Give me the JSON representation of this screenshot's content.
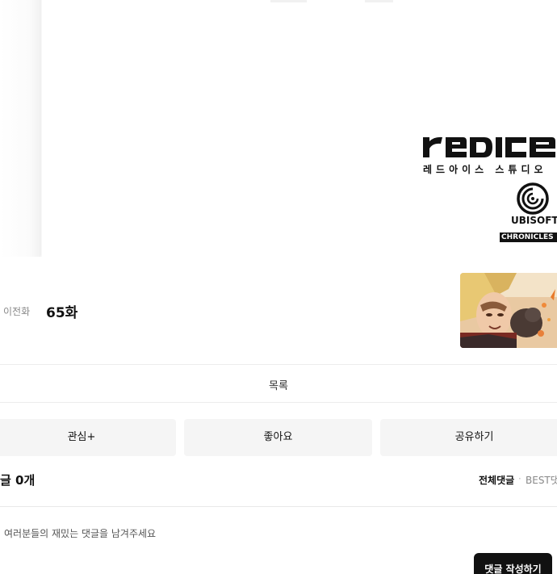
{
  "viewer": {
    "credits": {
      "studio_wordmark": "redice",
      "studio_name_ko": "레드아이스 스튜디오",
      "partner_name": "UBISOFT",
      "partner_tag": "CHRONICLES"
    }
  },
  "episode_nav": {
    "prev_label": "이전화",
    "episode_title": "65화"
  },
  "list_label": "목록",
  "actions": {
    "subscribe_label": "관심+",
    "like_label": "좋아요",
    "share_label": "공유하기"
  },
  "comments": {
    "count_label": "글 0개",
    "sort_all_label": "전체댓글",
    "sort_separator": "·",
    "sort_best_label": "BEST댓",
    "input_placeholder": "여러분들의 재밌는 댓글을 남겨주세요",
    "submit_label": "댓글 작성하기"
  },
  "colors": {
    "button_bg": "#f5f5f5",
    "submit_bg": "#111111",
    "muted_text": "#888888"
  }
}
